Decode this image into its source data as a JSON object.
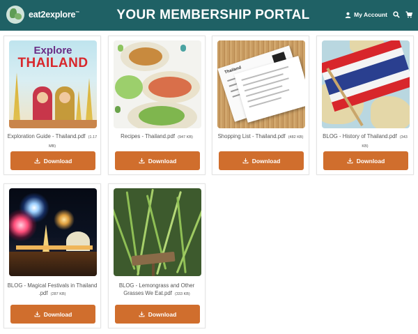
{
  "header": {
    "logo_text": "eat2explore",
    "logo_tm": "™",
    "title": "YOUR MEMBERSHIP PORTAL",
    "account_label": "My Account",
    "icons": [
      "user-icon",
      "search-icon",
      "cart-icon"
    ],
    "bg_color": "#1f6165"
  },
  "cards": [
    {
      "name": "Exploration Guide - Thailand.pdf",
      "size": "(1.17 MB)",
      "button": "Download",
      "thumb_text": [
        "Explore",
        "THAILAND"
      ]
    },
    {
      "name": "Recipes - Thailand.pdf",
      "size": "(947 KB)",
      "button": "Download"
    },
    {
      "name": "Shopping List - Thailand.pdf",
      "size": "(482 KB)",
      "button": "Download",
      "thumb_text": [
        "Thailand"
      ]
    },
    {
      "name": "BLOG - History of Thailand.pdf",
      "size": "(343 KB)",
      "button": "Download"
    },
    {
      "name": "BLOG - Magical Festivals in Thailand .pdf",
      "size": "(287 KB)",
      "button": "Download"
    },
    {
      "name": "BLOG - Lemongrass and Other Grasses We Eat.pdf",
      "size": "(333 KB)",
      "button": "Download"
    }
  ],
  "colors": {
    "button": "#d06e2d",
    "accent": "#1f6165"
  }
}
